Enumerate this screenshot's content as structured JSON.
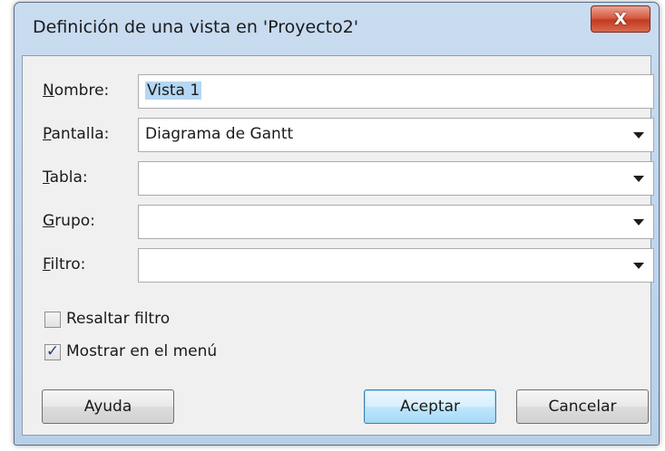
{
  "window": {
    "title": "Definición de una vista en 'Proyecto2'",
    "close_glyph": "X"
  },
  "form": {
    "nombre": {
      "label": "Nombre:",
      "value": "Vista 1"
    },
    "pantalla": {
      "label": "Pantalla:",
      "value": "Diagrama de Gantt"
    },
    "tabla": {
      "label": "Tabla:",
      "value": ""
    },
    "grupo": {
      "label": "Grupo:",
      "value": ""
    },
    "filtro": {
      "label": "Filtro:",
      "value": ""
    }
  },
  "options": {
    "resaltar_filtro": {
      "label": "Resaltar filtro",
      "checked": false
    },
    "mostrar_en_menu": {
      "label": "Mostrar en el menú",
      "checked": true
    }
  },
  "buttons": {
    "ayuda": "Ayuda",
    "aceptar": "Aceptar",
    "cancelar": "Cancelar"
  },
  "icons": {
    "close": "close-icon",
    "dropdown": "chevron-down-icon",
    "check": "checkmark-icon"
  },
  "colors": {
    "title_bar": "#c9dcf0",
    "close_button": "#c13a22",
    "selection": "#b5d7f4",
    "default_button_border": "#3c7fb1"
  }
}
